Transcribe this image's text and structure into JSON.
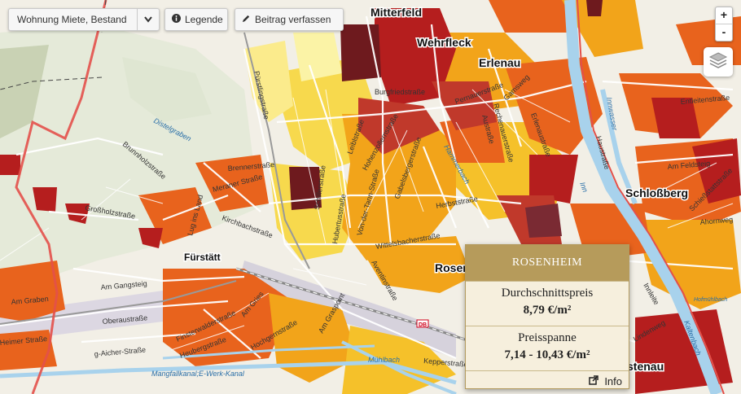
{
  "controls": {
    "region_select_value": "Wohnung Miete, Bestand",
    "legend_label": "Legende",
    "post_label": "Beitrag verfassen"
  },
  "zoom": {
    "in_label": "+",
    "out_label": "-"
  },
  "popup": {
    "title": "ROSENHEIM",
    "avg_label": "Durchschnittspreis",
    "avg_value": "8,79 €/m²",
    "range_label": "Preisspanne",
    "range_value": "7,14 - 10,43 €/m²",
    "info_label": "Info"
  },
  "colors": {
    "high": "#b51e1e",
    "very_high": "#6e1a1e",
    "mid_high": "#e8631d",
    "mid": "#f2a41a",
    "low": "#f7d94d",
    "very_low": "#fbf3a6",
    "river": "#a8d2ec",
    "boundary": "#e3504a",
    "popup_header": "#b69b5b"
  },
  "map": {
    "places": [
      "Mitterfeld",
      "Wehrfleck",
      "Erlenau",
      "Schloßberg",
      "Fürstätt",
      "Rosen",
      "stenau"
    ],
    "streets": [
      "Pürstlingstraße",
      "Burgfriedstraße",
      "Pernauerstraße",
      "Gamsweg",
      "Rechenauerstraße",
      "Austraße",
      "Erlenaustraße",
      "Hohenzollernstraße",
      "Leiblstraße",
      "Gabelsbergerstraße",
      "Herbststraße",
      "Wittelsbacherstraße",
      "Von-der-Tann-Straße",
      "Hubertusstraße",
      "Schillerstraße",
      "Ebersberger",
      "Brennerstraße",
      "Meraner Straße",
      "Kirchbachstraße",
      "Lug ins Land",
      "Brunnholzstraße",
      "Großholzstraße",
      "Am Gangsteig",
      "Oberaustraße",
      "Finsterwalderstraße",
      "Heubergstraße",
      "Hochgernstraße",
      "Am Gries",
      "Am Graspoint",
      "Aventinstraße",
      "Kepperstraße",
      "Richard-Wagner-Straße",
      "Entleitenstraße",
      "Am Feldsteig",
      "Ahornweg",
      "Schießstattstraße",
      "Innleite",
      "Lindenweg",
      "Dr.-Seitz-Str.",
      "Brucknerstraße",
      "Bahnhofstraße",
      "Innstraße",
      "Am Graben",
      "Heimer Straße",
      "g-Aicher-Straße",
      "Herbstraße",
      "Haustraße",
      "Mangfallkanal; E-Werk-Kanal"
    ],
    "water": [
      "Distelgraben",
      "Mangfallkanal;E-Werk-Kanal",
      "Mühlbach",
      "Hammerbach",
      "Inn",
      "Hofmühlbach",
      "Innwasser",
      "Kaltenbach"
    ]
  }
}
